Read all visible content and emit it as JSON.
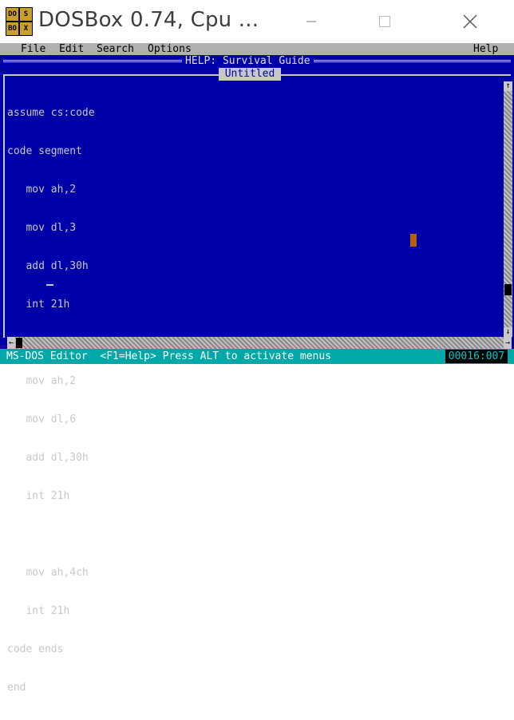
{
  "window": {
    "title": "DOSBox 0.74, Cpu ...",
    "icon_text": [
      "DO",
      "S",
      "BO",
      "X"
    ]
  },
  "icons": {
    "app": "dosbox-icon",
    "minimize": "minimize-icon",
    "maximize": "maximize-icon",
    "close": "close-icon"
  },
  "menu": {
    "file": "File",
    "edit": "Edit",
    "search": "Search",
    "options": "Options",
    "help": "Help"
  },
  "help_title": "HELP: Survival Guide",
  "document": {
    "name": "Untitled",
    "lines": [
      "assume cs:code",
      "code segment",
      "   mov ah,2",
      "   mov dl,3",
      "   add dl,30h",
      "   int 21h",
      "",
      "   mov ah,2",
      "   mov dl,6",
      "   add dl,30h",
      "   int 21h",
      "",
      "   mov ah,4ch",
      "   int 21h",
      "code ends",
      "end"
    ]
  },
  "status": {
    "message": "MS-DOS Editor  <F1=Help> Press ALT to activate menus",
    "position": "00016:007"
  },
  "colors": {
    "screen_bg": "#0000a8",
    "text": "#c8c8c8",
    "menu_bg": "#b0b0b0",
    "status_bg": "#00a8a8"
  }
}
